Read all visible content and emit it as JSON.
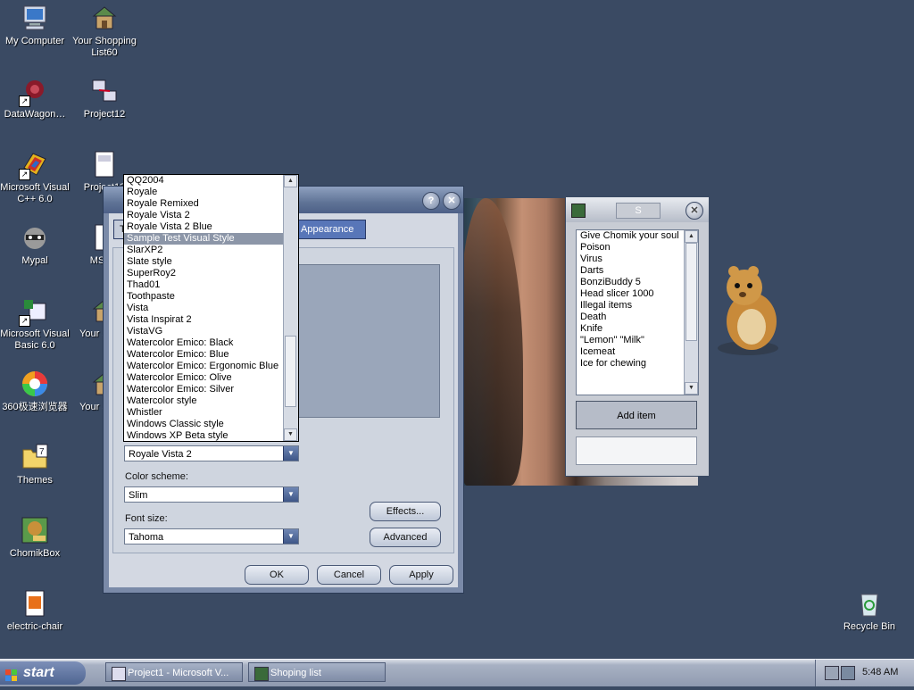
{
  "desktop_icons": [
    {
      "label": "My Computer"
    },
    {
      "label": "Your Shopping List60"
    },
    {
      "label": "DataWagon…"
    },
    {
      "label": "Project12"
    },
    {
      "label": "Microsoft Visual C++ 6.0"
    },
    {
      "label": "Project13"
    },
    {
      "label": "Mypal"
    },
    {
      "label": "MSSO"
    },
    {
      "label": "Microsoft Visual Basic 6.0"
    },
    {
      "label": "Your Sh Lis"
    },
    {
      "label": "360极速浏览器"
    },
    {
      "label": "Your Sh Lis"
    },
    {
      "label": "Themes"
    },
    {
      "label": "ChomikBox"
    },
    {
      "label": "electric-chair"
    },
    {
      "label": "Recycle Bin"
    }
  ],
  "display_dialog": {
    "tab_first": "Th",
    "tab_appearance": "Appearance",
    "windows_buttons_value": "Royale Vista 2",
    "color_scheme_label": "Color scheme:",
    "color_scheme_value": "Slim",
    "font_size_label": "Font size:",
    "font_size_value": "Tahoma",
    "effects_button": "Effects...",
    "advanced_button": "Advanced",
    "ok_button": "OK",
    "cancel_button": "Cancel",
    "apply_button": "Apply"
  },
  "style_dropdown": {
    "selected": "Sample Test Visual Style",
    "items": [
      "QQ2004",
      "Royale",
      "Royale Remixed",
      "Royale Vista 2",
      "Royale Vista 2 Blue",
      "Sample Test Visual Style",
      "SlarXP2",
      "Slate style",
      "SuperRoy2",
      "Thad01",
      "Toothpaste",
      "Vista",
      "Vista Inspirat 2",
      "VistaVG",
      "Watercolor Emico: Black",
      "Watercolor Emico: Blue",
      "Watercolor Emico: Ergonomic Blue",
      "Watercolor Emico: Olive",
      "Watercolor Emico: Silver",
      "Watercolor style",
      "Whistler",
      "Windows Classic style",
      "Windows XP Beta style"
    ]
  },
  "shopping_list": {
    "title": "S",
    "items": [
      "Give Chomik your soul",
      "Poison",
      "Virus",
      "Darts",
      "BonziBuddy 5",
      "Head slicer 1000",
      "Illegal items",
      "Death",
      "Knife",
      "\"Lemon\" \"Milk\"",
      "Icemeat",
      "Ice for chewing"
    ],
    "add_button": "Add item",
    "input_value": ""
  },
  "taskbar": {
    "start_label": "start",
    "tasks": [
      {
        "label": "Project1 - Microsoft V..."
      },
      {
        "label": "Shoping list"
      }
    ],
    "clock": "5:48 AM"
  },
  "colors": {
    "desktop": "#3a4a63",
    "selection": "#8c96a8"
  }
}
